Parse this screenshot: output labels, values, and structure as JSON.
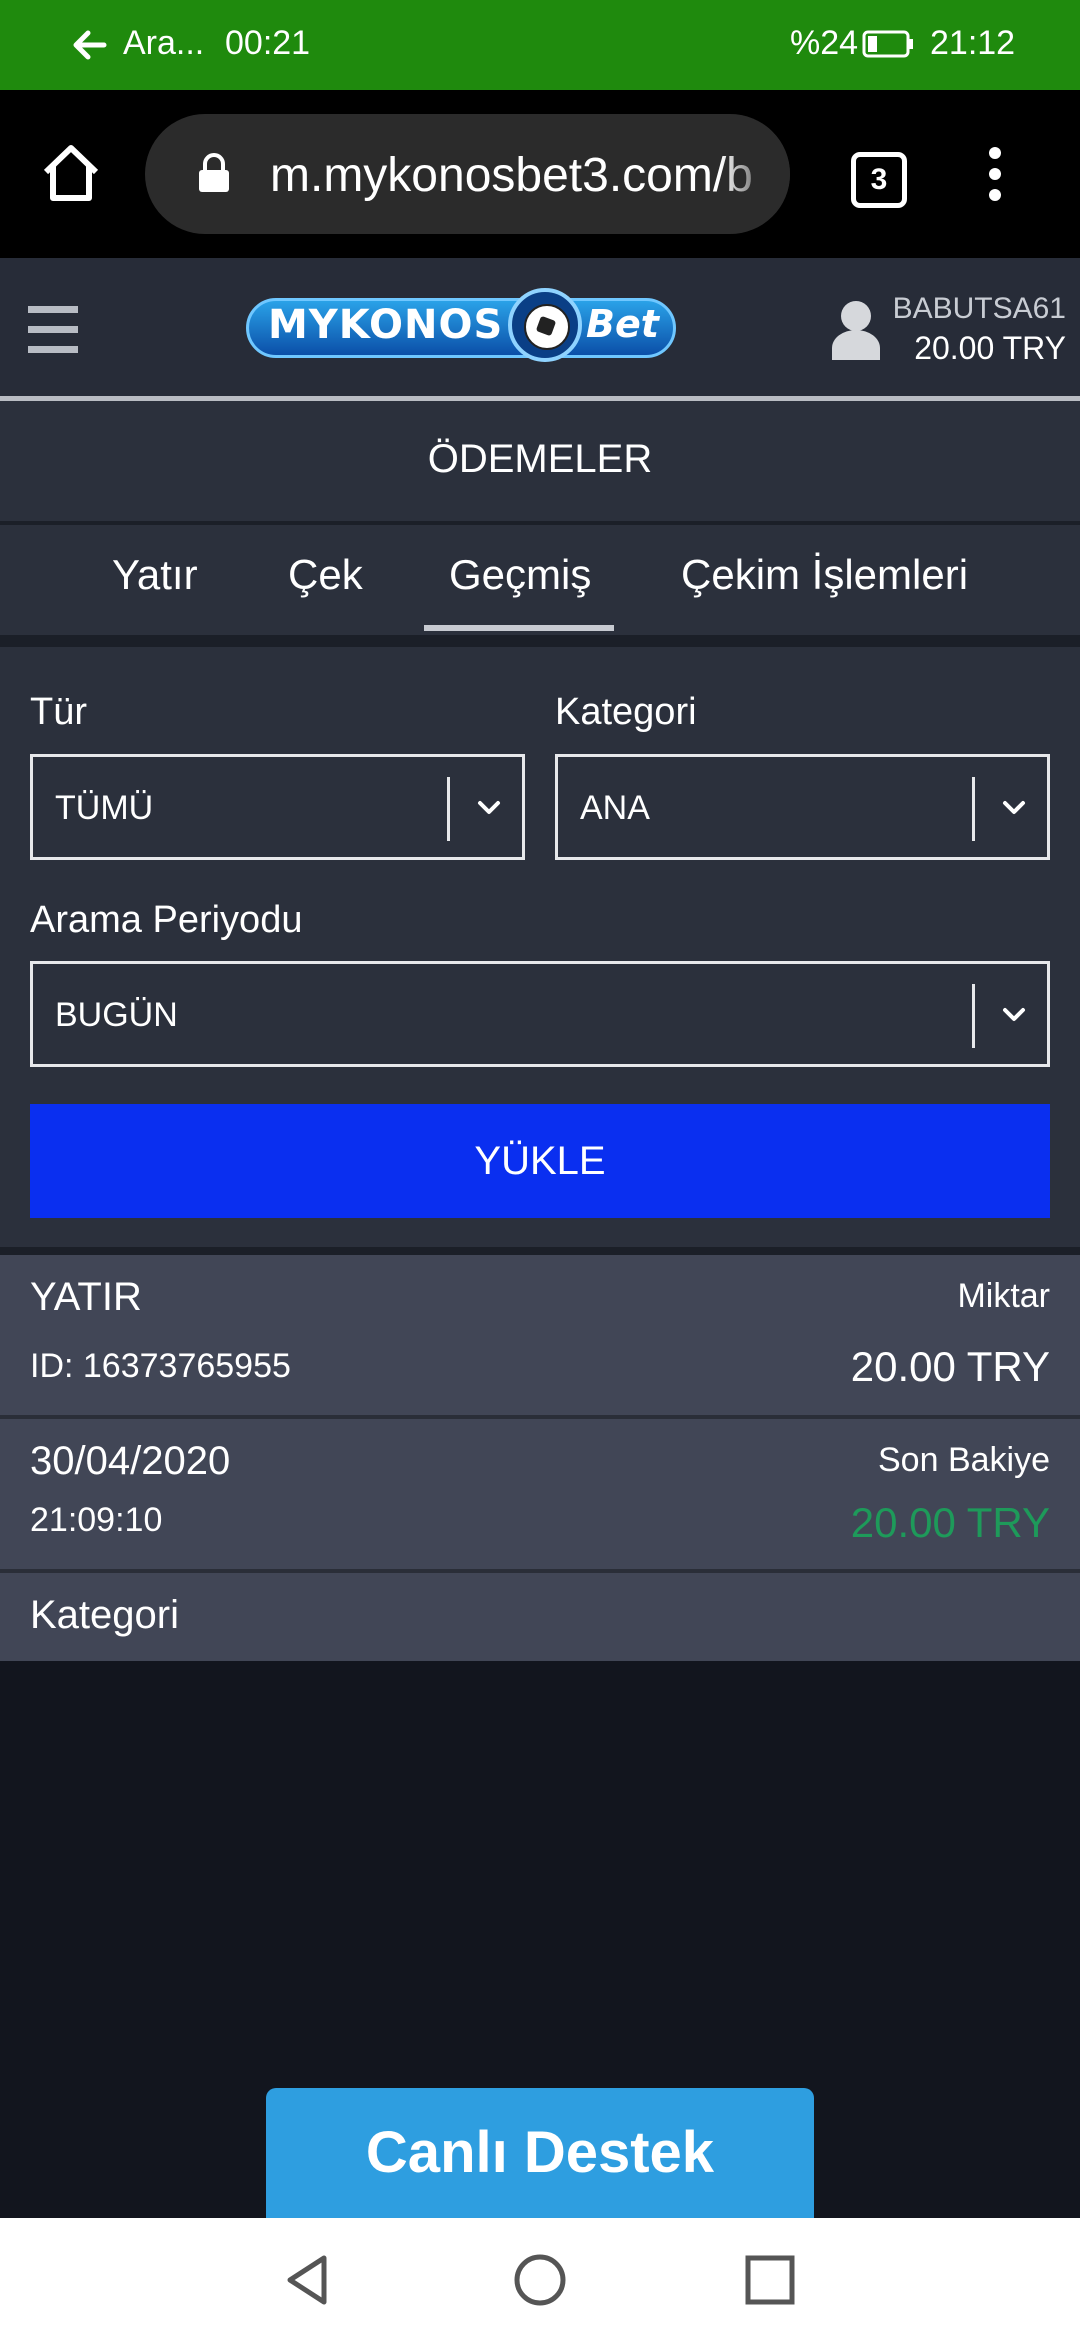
{
  "status_bar": {
    "app_label": "Ara...",
    "timer": "00:21",
    "battery_percent": "%24",
    "clock": "21:12"
  },
  "browser": {
    "url": "m.mykonosbet3.com/b",
    "tab_count": "3"
  },
  "header": {
    "logo_text": "MYKONOS",
    "logo_suffix": "Bet",
    "username": "BABUTSA61",
    "balance": "20.00 TRY"
  },
  "page": {
    "title": "ÖDEMELER"
  },
  "tabs": [
    {
      "label": "Yatır",
      "active": false
    },
    {
      "label": "Çek",
      "active": false
    },
    {
      "label": "Geçmiş",
      "active": true
    },
    {
      "label": "Çekim İşlemleri",
      "active": false
    }
  ],
  "filters": {
    "type_label": "Tür",
    "type_value": "TÜMÜ",
    "category_label": "Kategori",
    "category_value": "ANA",
    "period_label": "Arama Periyodu",
    "period_value": "BUGÜN",
    "load_button": "YÜKLE"
  },
  "transaction": {
    "type": "YATIR",
    "id": "ID: 16373765955",
    "amount_label": "Miktar",
    "amount": "20.00 TRY",
    "date": "30/04/2020",
    "time": "21:09:10",
    "balance_label": "Son Bakiye",
    "balance": "20.00 TRY",
    "category_label": "Kategori"
  },
  "support": {
    "label": "Canlı Destek"
  },
  "colors": {
    "status_bar": "#1f8a0d",
    "load_button": "#0a2ff0",
    "support_button": "#2e9ee0",
    "positive_balance": "#1e9a5a"
  }
}
